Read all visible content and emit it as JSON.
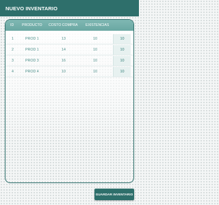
{
  "app_bar": {
    "title": "NUEVO INVENTARIO",
    "color": "#2e6f6b"
  },
  "table": {
    "columns": [
      "ID",
      "PRODUCTO",
      "COSTO COMPRA",
      "EXISTENCIAS"
    ],
    "rows": [
      {
        "id": "1",
        "producto": "PROD 1",
        "costo_compra": "13",
        "existencias": "10",
        "cantidad": "10"
      },
      {
        "id": "2",
        "producto": "PROD 1",
        "costo_compra": "14",
        "existencias": "10",
        "cantidad": "10"
      },
      {
        "id": "3",
        "producto": "PROD 3",
        "costo_compra": "16",
        "existencias": "10",
        "cantidad": "10"
      },
      {
        "id": "4",
        "producto": "PROD 4",
        "costo_compra": "10",
        "existencias": "10",
        "cantidad": "10"
      }
    ]
  },
  "footer": {
    "save_label": "GUARDAR INVENTARIO"
  }
}
